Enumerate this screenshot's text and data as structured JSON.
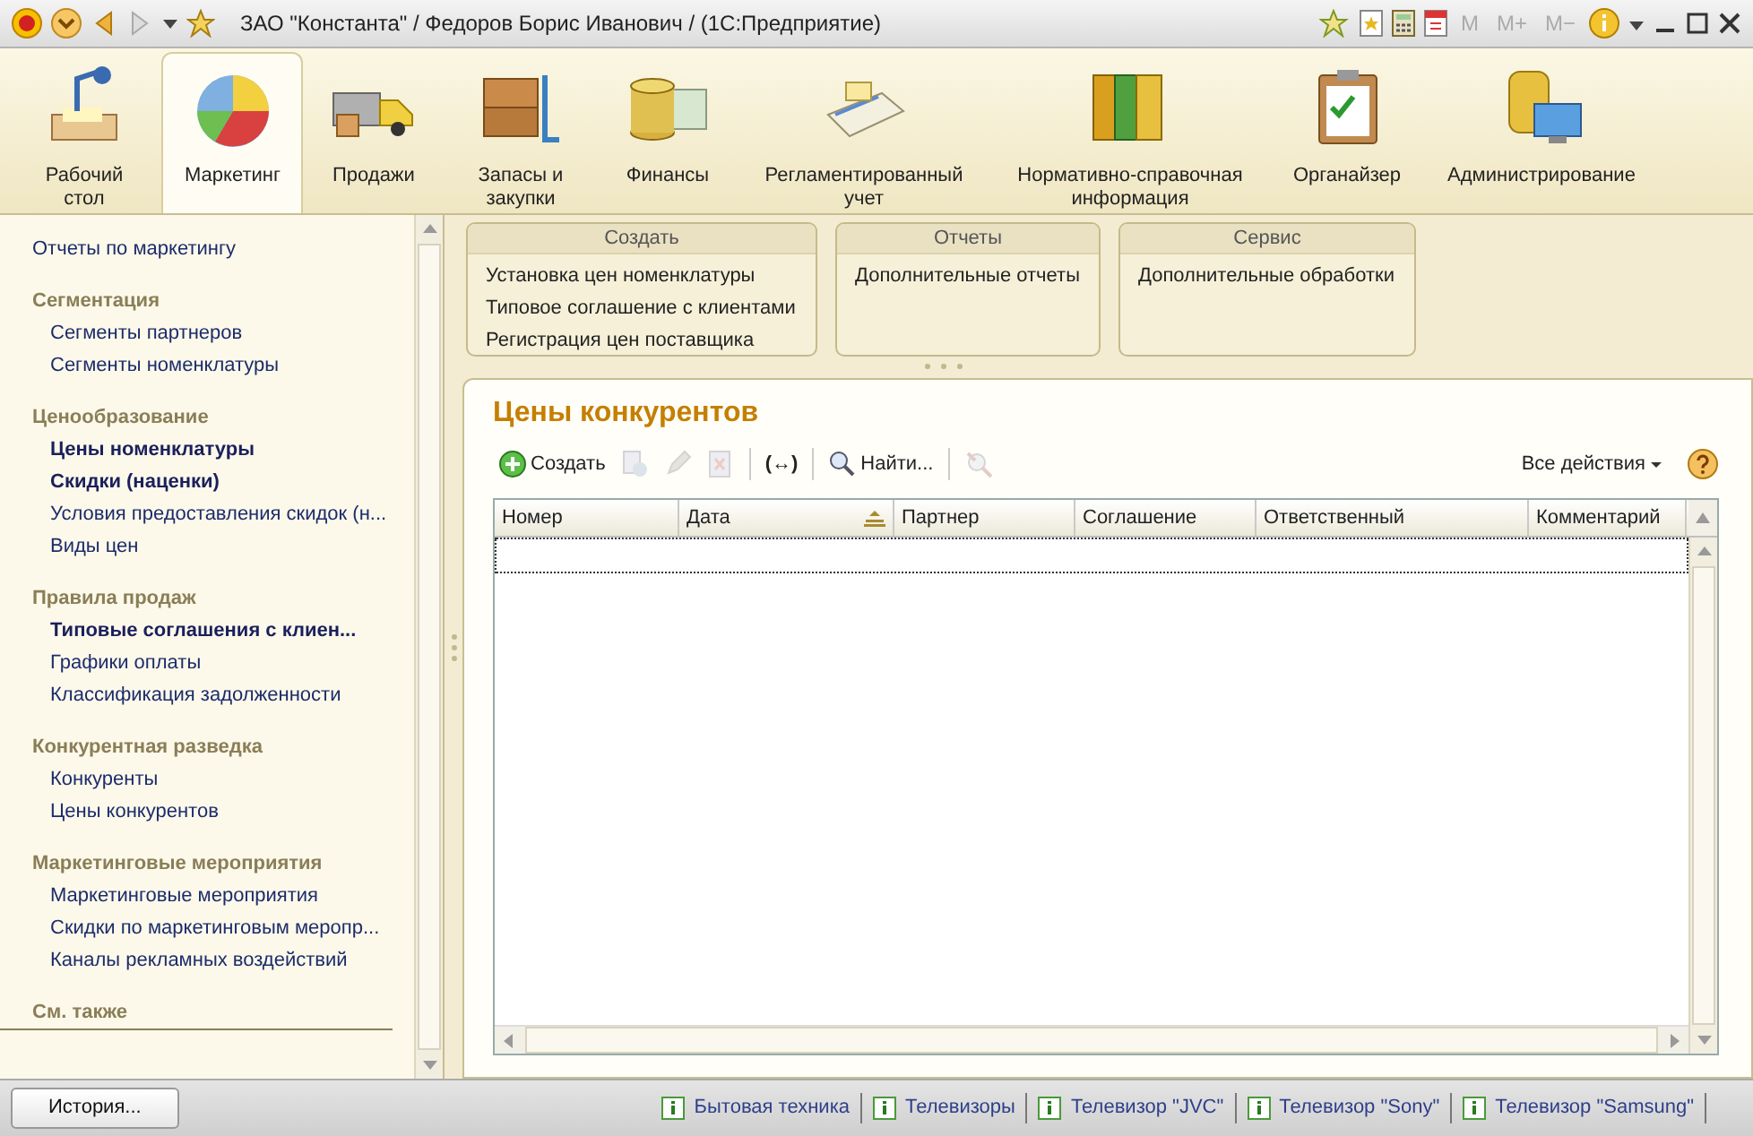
{
  "window": {
    "title": "ЗАО \"Константа\" / Федоров Борис Иванович / (1С:Предприятие)",
    "memory_buttons": [
      "M",
      "M+",
      "M−"
    ]
  },
  "sections": [
    {
      "label": "Рабочий стол",
      "selected": false
    },
    {
      "label": "Маркетинг",
      "selected": true
    },
    {
      "label": "Продажи",
      "selected": false
    },
    {
      "label": "Запасы и закупки",
      "selected": false
    },
    {
      "label": "Финансы",
      "selected": false
    },
    {
      "label": "Регламентированный учет",
      "selected": false
    },
    {
      "label": "Нормативно-справочная информация",
      "selected": false
    },
    {
      "label": "Органайзер",
      "selected": false
    },
    {
      "label": "Администрирование",
      "selected": false
    }
  ],
  "sidebar": {
    "items": [
      {
        "kind": "link",
        "label": "Отчеты по маркетингу",
        "emphasized": false
      },
      {
        "kind": "header",
        "label": "Сегментация"
      },
      {
        "kind": "sublink",
        "label": "Сегменты партнеров",
        "emphasized": false
      },
      {
        "kind": "sublink",
        "label": "Сегменты номенклатуры",
        "emphasized": false
      },
      {
        "kind": "header",
        "label": "Ценообразование"
      },
      {
        "kind": "sublink",
        "label": "Цены номенклатуры",
        "emphasized": true
      },
      {
        "kind": "sublink",
        "label": "Скидки (наценки)",
        "emphasized": true
      },
      {
        "kind": "sublink",
        "label": "Условия предоставления скидок (н...",
        "emphasized": false
      },
      {
        "kind": "sublink",
        "label": "Виды цен",
        "emphasized": false
      },
      {
        "kind": "header",
        "label": "Правила продаж"
      },
      {
        "kind": "sublink",
        "label": "Типовые соглашения с клиен...",
        "emphasized": true
      },
      {
        "kind": "sublink",
        "label": "Графики оплаты",
        "emphasized": false
      },
      {
        "kind": "sublink",
        "label": "Классификация задолженности",
        "emphasized": false
      },
      {
        "kind": "header",
        "label": "Конкурентная разведка"
      },
      {
        "kind": "sublink",
        "label": "Конкуренты",
        "emphasized": false
      },
      {
        "kind": "sublink",
        "label": "Цены конкурентов",
        "emphasized": false
      },
      {
        "kind": "header",
        "label": "Маркетинговые мероприятия"
      },
      {
        "kind": "sublink",
        "label": "Маркетинговые мероприятия",
        "emphasized": false
      },
      {
        "kind": "sublink",
        "label": "Скидки по маркетинговым меропр...",
        "emphasized": false
      },
      {
        "kind": "sublink",
        "label": "Каналы рекламных воздействий",
        "emphasized": false
      },
      {
        "kind": "header",
        "label": "См. также",
        "underlined": true
      }
    ]
  },
  "command_groups": [
    {
      "title": "Создать",
      "items": [
        "Установка цен номенклатуры",
        "Типовое соглашение с клиентами",
        "Регистрация цен поставщика"
      ]
    },
    {
      "title": "Отчеты",
      "items": [
        "Дополнительные отчеты"
      ]
    },
    {
      "title": "Сервис",
      "items": [
        "Дополнительные обработки"
      ]
    }
  ],
  "form": {
    "title": "Цены конкурентов",
    "toolbar": [
      {
        "kind": "create",
        "label": "Создать",
        "disabled": false
      },
      {
        "kind": "copy",
        "disabled": true
      },
      {
        "kind": "edit",
        "disabled": true
      },
      {
        "kind": "delete",
        "disabled": true
      },
      {
        "kind": "separator"
      },
      {
        "kind": "text",
        "label": "(↔)",
        "disabled": false
      },
      {
        "kind": "separator"
      },
      {
        "kind": "find",
        "label": "Найти...",
        "disabled": false
      },
      {
        "kind": "separator"
      },
      {
        "kind": "clear-find",
        "disabled": true
      }
    ],
    "all_actions": "Все действия",
    "table": {
      "columns": [
        {
          "label": "Номер",
          "sorted": false
        },
        {
          "label": "Дата",
          "sorted": true
        },
        {
          "label": "Партнер",
          "sorted": false
        },
        {
          "label": "Соглашение",
          "sorted": false
        },
        {
          "label": "Ответственный",
          "sorted": false
        },
        {
          "label": "Комментарий",
          "sorted": false
        }
      ]
    }
  },
  "status_bar": {
    "history_button": "История...",
    "history": [
      "Бытовая техника",
      "Телевизоры",
      "Телевизор \"JVC\"",
      "Телевизор \"Sony\"",
      "Телевизор \"Samsung\""
    ]
  }
}
